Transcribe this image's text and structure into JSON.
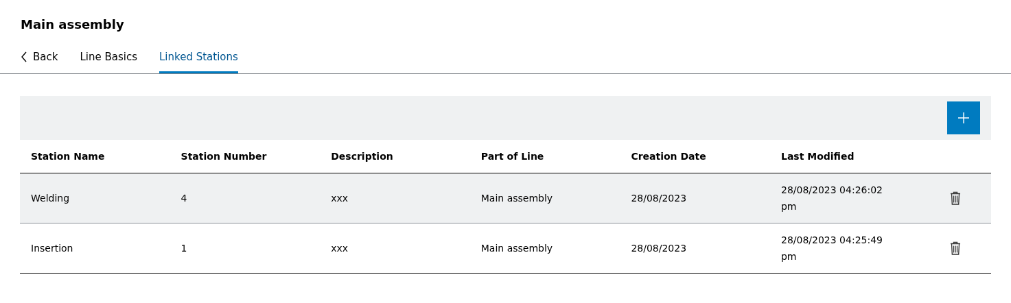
{
  "page": {
    "title": "Main assembly"
  },
  "back": {
    "label": "Back"
  },
  "tabs": [
    {
      "label": "Line Basics",
      "selected": false
    },
    {
      "label": "Linked Stations",
      "selected": true
    }
  ],
  "table": {
    "columns": [
      "Station Name",
      "Station Number",
      "Description",
      "Part of Line",
      "Creation Date",
      "Last Modified"
    ],
    "rows": [
      {
        "selected": true,
        "cells": [
          "Welding",
          "4",
          "xxx",
          "Main assembly",
          "28/08/2023",
          "28/08/2023 04:26:02 pm"
        ]
      },
      {
        "selected": false,
        "cells": [
          "Insertion",
          "1",
          "xxx",
          "Main assembly",
          "28/08/2023",
          "28/08/2023 04:25:49 pm"
        ]
      }
    ]
  }
}
